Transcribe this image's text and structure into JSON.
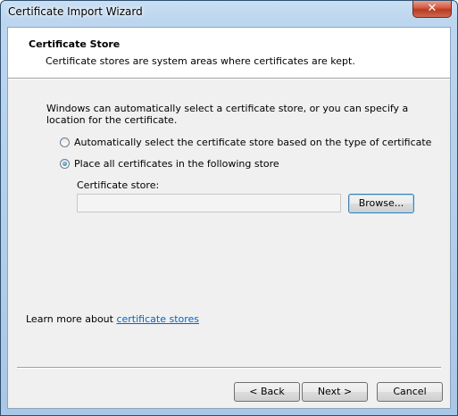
{
  "window": {
    "title": "Certificate Import Wizard",
    "close_label": "✕"
  },
  "header": {
    "title": "Certificate Store",
    "subtitle": "Certificate stores are system areas where certificates are kept."
  },
  "intro": "Windows can automatically select a certificate store, or you can specify a location for the certificate.",
  "options": {
    "auto": {
      "label": "Automatically select the certificate store based on the type of certificate",
      "selected": false
    },
    "manual": {
      "label": "Place all certificates in the following store",
      "selected": true
    }
  },
  "store": {
    "label": "Certificate store:",
    "value": "",
    "browse_label": "Browse..."
  },
  "learn_more": {
    "prefix": "Learn more about ",
    "link": "certificate stores"
  },
  "buttons": {
    "back": "< Back",
    "next": "Next >",
    "cancel": "Cancel"
  }
}
